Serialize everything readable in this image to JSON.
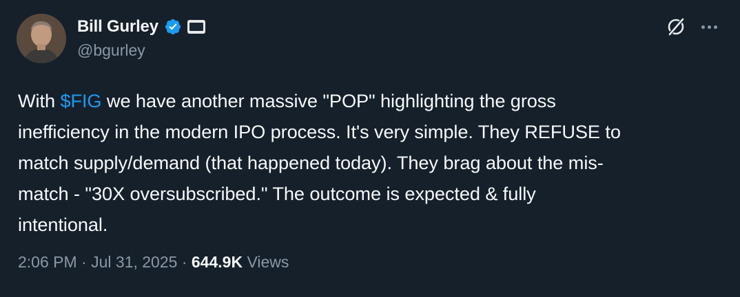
{
  "author": {
    "display_name": "Bill Gurley",
    "handle": "@bgurley",
    "verified": true,
    "avatar_icon": "profile-photo"
  },
  "icons": {
    "verified": "verified-checkmark-icon",
    "affiliate": "affiliate-badge-icon",
    "grok": "grok-icon",
    "more": "more-options-icon"
  },
  "colors": {
    "background": "#15202b",
    "text": "#f7f9f9",
    "secondary": "#8b98a5",
    "accent": "#1d9bf0"
  },
  "tweet": {
    "line1_pre": "With ",
    "cashtag": "$FIG",
    "line1_post": " we have another massive \"POP\" highlighting the gross",
    "line2": "inefficiency in the modern IPO process. It's very simple. They REFUSE to",
    "line3": "match supply/demand (that happened today). They brag about the mis-",
    "line4": "match - \"30X oversubscribed.\" The outcome is expected & fully",
    "line5": "intentional."
  },
  "meta": {
    "time": "2:06 PM",
    "separator": " · ",
    "date": "Jul 31, 2025",
    "views_count": "644.9K",
    "views_label": " Views"
  }
}
